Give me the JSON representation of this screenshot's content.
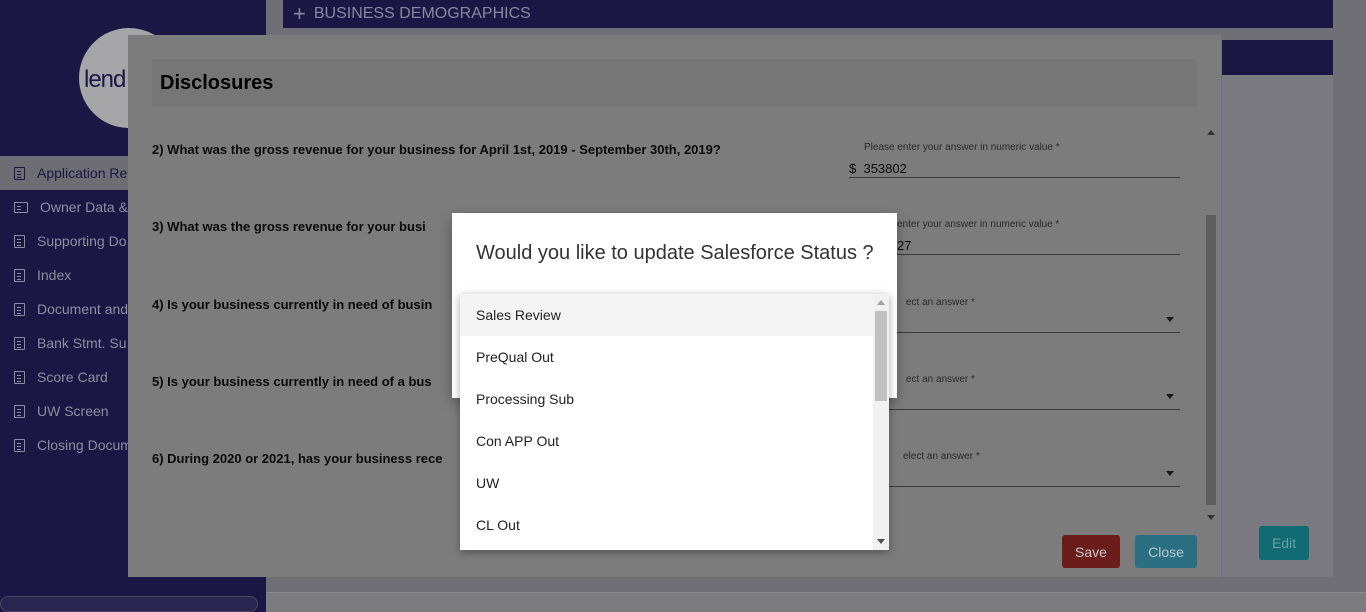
{
  "app": {
    "logo_text": "lend"
  },
  "sidebar": {
    "items": [
      {
        "label": "Application Re",
        "icon": "document-icon",
        "active": true
      },
      {
        "label": "Owner Data &",
        "icon": "image-icon"
      },
      {
        "label": "Supporting Do",
        "icon": "document-icon"
      },
      {
        "label": "Index",
        "icon": "document-icon"
      },
      {
        "label": "Document and",
        "icon": "document-icon"
      },
      {
        "label": "Bank Stmt. Su",
        "icon": "document-icon"
      },
      {
        "label": "Score Card",
        "icon": "document-icon"
      },
      {
        "label": "UW Screen",
        "icon": "document-icon"
      },
      {
        "label": "Closing Docum",
        "icon": "document-icon"
      }
    ]
  },
  "main": {
    "section_bar": {
      "icon": "plus-icon",
      "label": "BUSINESS DEMOGRAPHICS"
    },
    "edit_label": "Edit"
  },
  "disclosures": {
    "title": "Disclosures",
    "questions": [
      {
        "text": "2) What was the gross revenue for your business for April 1st, 2019 - September 30th, 2019?",
        "field_label": "Please enter your answer in numeric value *",
        "prefix": "$",
        "value": "353802"
      },
      {
        "text": "3) What was the gross revenue for your busi",
        "field_label": "enter your answer in numeric value *",
        "prefix": "",
        "value": "27"
      },
      {
        "text": "4) Is your business currently in need of busin",
        "field_label": "ect an answer *",
        "prefix": "",
        "value": ""
      },
      {
        "text": "5) Is your business currently in need of a bus",
        "field_label": "ect an answer *",
        "prefix": "",
        "value": ""
      },
      {
        "text": "6) During 2020 or 2021, has your business rece",
        "field_label": "elect an answer *",
        "prefix": "",
        "value": ""
      }
    ],
    "save_label": "Save",
    "close_label": "Close"
  },
  "dialog": {
    "title": "Would you like to update Salesforce Status ?",
    "options": [
      "Sales Review",
      "PreQual Out",
      "Processing Sub",
      "Con APP Out",
      "UW",
      "CL Out"
    ],
    "highlighted": "Sales Review"
  },
  "colors": {
    "sidebar": "#1c1645",
    "save": "#6a1d1b",
    "close": "#2b6f83",
    "edit": "#116b73"
  }
}
